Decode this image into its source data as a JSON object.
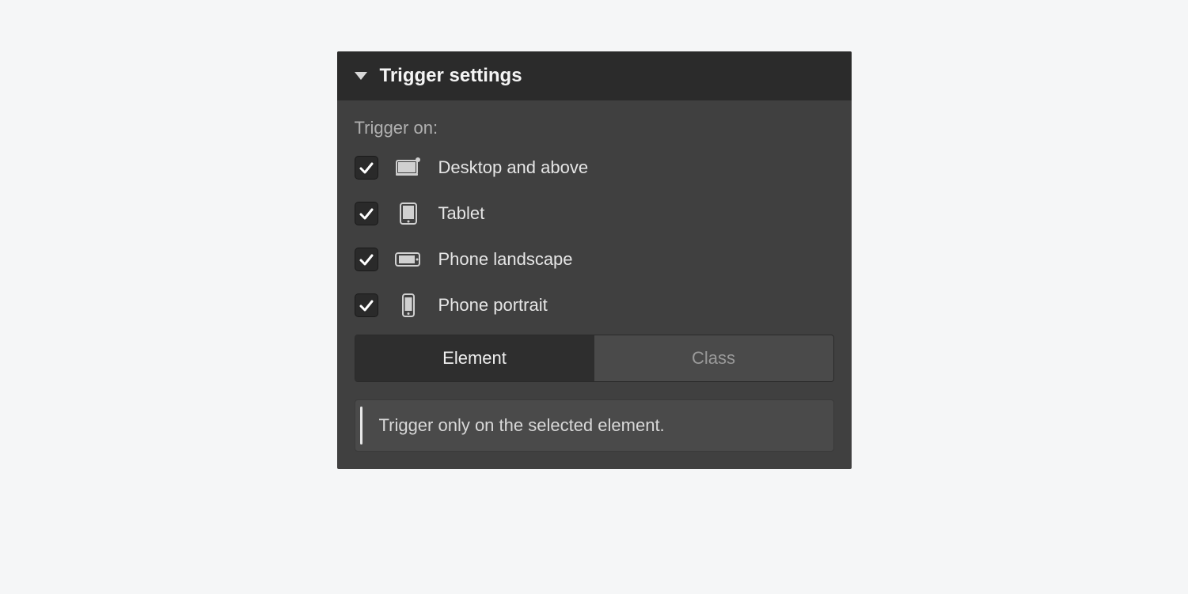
{
  "panel": {
    "title": "Trigger settings",
    "subtitle": "Trigger on:",
    "options": [
      {
        "label": "Desktop and above",
        "checked": true,
        "icon": "desktop"
      },
      {
        "label": "Tablet",
        "checked": true,
        "icon": "tablet"
      },
      {
        "label": "Phone landscape",
        "checked": true,
        "icon": "phone-landscape"
      },
      {
        "label": "Phone portrait",
        "checked": true,
        "icon": "phone-portrait"
      }
    ],
    "toggle": {
      "options": [
        "Element",
        "Class"
      ],
      "active": "Element"
    },
    "info": "Trigger only on the selected element."
  }
}
